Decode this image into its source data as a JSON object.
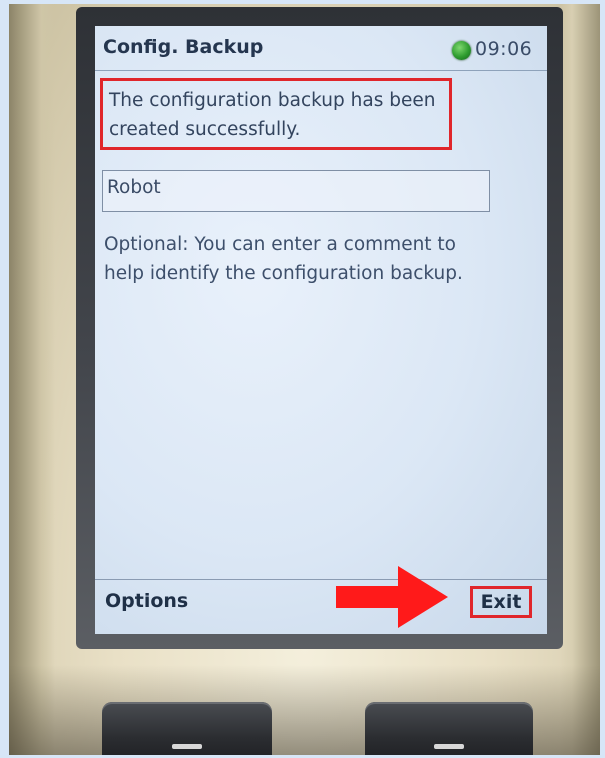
{
  "screen": {
    "title": "Config. Backup",
    "clock": "09:06",
    "status_indicator": "green-led",
    "message": "The configuration backup has been created successfully.",
    "comment_field": {
      "value": "Robot"
    },
    "hint": "Optional: You can enter a comment to help identify the configuration backup.",
    "softkeys": {
      "left": "Options",
      "right": "Exit"
    }
  },
  "annotations": {
    "highlight_color": "#e0262b",
    "arrow_color": "#ff1a1a"
  }
}
